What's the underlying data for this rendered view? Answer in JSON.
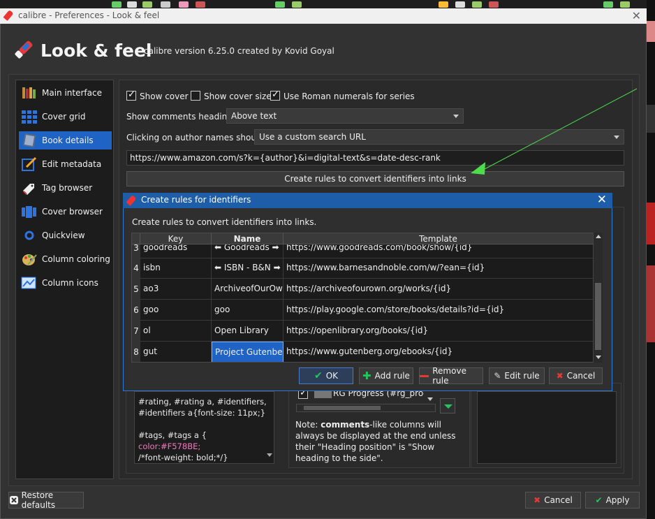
{
  "window": {
    "title": "calibre - Preferences - Look & feel",
    "close_glyph": "✕"
  },
  "header": {
    "title": "Look & feel",
    "version_text": "calibre version 6.25.0 created by Kovid Goyal"
  },
  "sidebar": {
    "items": [
      {
        "label": "Main interface",
        "icon": "main-interface-icon"
      },
      {
        "label": "Cover grid",
        "icon": "cover-grid-icon"
      },
      {
        "label": "Book details",
        "icon": "book-details-icon",
        "selected": true
      },
      {
        "label": "Edit metadata",
        "icon": "edit-metadata-icon"
      },
      {
        "label": "Tag browser",
        "icon": "tag-browser-icon"
      },
      {
        "label": "Cover browser",
        "icon": "cover-browser-icon"
      },
      {
        "label": "Quickview",
        "icon": "quickview-icon"
      },
      {
        "label": "Column coloring",
        "icon": "column-coloring-icon"
      },
      {
        "label": "Column icons",
        "icon": "column-icons-icon"
      }
    ]
  },
  "book_details": {
    "show_cover": {
      "label": "Show cover",
      "checked": true
    },
    "show_cover_size": {
      "label": "Show cover size",
      "checked": false
    },
    "roman_numerals": {
      "label": "Use Roman numerals for series",
      "checked": true
    },
    "comments_heading_label": "Show comments heading:",
    "comments_heading_value": "Above text",
    "author_click_label": "Clicking on author names should:",
    "author_click_value": "Use a custom search URL",
    "search_url": "https://www.amazon.com/s?k={author}&i=digital-text&s=date-desc-rank",
    "create_rules_button": "Create rules to convert identifiers into links"
  },
  "dialog": {
    "title": "Create rules for identifiers",
    "close_glyph": "✕",
    "description": "Create rules to convert identifiers into links.",
    "columns": [
      "Key",
      "Name",
      "Template"
    ],
    "rows": [
      {
        "num": "3",
        "key": "goodreads",
        "name": "⬅ Goodreads ➡",
        "template": "https://www.goodreads.com/book/show/{id}"
      },
      {
        "num": "4",
        "key": "isbn",
        "name": "⬅ ISBN - B&N ➡",
        "template": "https://www.barnesandnoble.com/w/?ean={id}"
      },
      {
        "num": "5",
        "key": "ao3",
        "name": "ArchiveofOurOwn",
        "template": "https://archiveofourown.org/works/{id}"
      },
      {
        "num": "6",
        "key": "goo",
        "name": "goo",
        "template": "https://play.google.com/store/books/details?id={id}"
      },
      {
        "num": "7",
        "key": "ol",
        "name": "Open Library",
        "template": "https://openlibrary.org/books/{id}"
      },
      {
        "num": "8",
        "key": "gut",
        "name": "Project Gutenberg",
        "template": "https://www.gutenberg.org/ebooks/{id}",
        "selected": true
      }
    ],
    "buttons": {
      "ok": "OK",
      "add_rule": "Add rule",
      "remove_rule": "Remove rule",
      "edit_rule": "Edit rule",
      "cancel": "Cancel"
    }
  },
  "css_box": {
    "lines": [
      "#rating, #rating a, #identifiers,",
      "#identifiers  a{font-size: 11px;}",
      "",
      " #tags, #tags a {",
      "color:#F578BE;",
      "   /*font-weight: bold;*/}"
    ]
  },
  "display_fields": {
    "partial_item": "RG Progress (#rg_progres"
  },
  "note": {
    "bold": "comments",
    "prefix": "Note: ",
    "text": "-like columns will always be displayed at the end unless their \"Heading position\" is \"Show heading to the side\"."
  },
  "footer": {
    "restore_defaults": "Restore defaults",
    "cancel": "Cancel",
    "apply": "Apply"
  },
  "colors": {
    "accent": "#1f63c4",
    "annotation_arrow": "#4cdc4c",
    "ok_check": "#22c55e",
    "cancel_x": "#e53935"
  }
}
